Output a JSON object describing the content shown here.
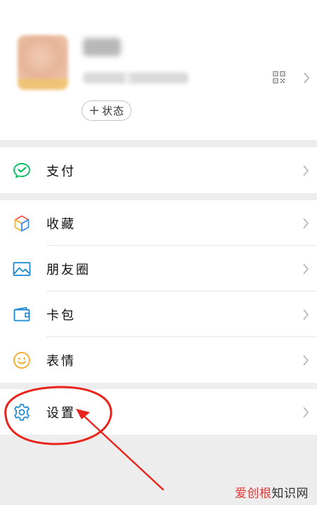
{
  "profile": {
    "status_button_plus": "+",
    "status_button_label": "状态"
  },
  "menu": {
    "pay": {
      "label": "支付",
      "icon": "wechat-pay-icon"
    },
    "favorites": {
      "label": "收藏",
      "icon": "favorites-cube-icon"
    },
    "moments": {
      "label": "朋友圈",
      "icon": "moments-photo-icon"
    },
    "cards": {
      "label": "卡包",
      "icon": "card-wallet-icon"
    },
    "stickers": {
      "label": "表情",
      "icon": "smiley-icon"
    },
    "settings": {
      "label": "设置",
      "icon": "gear-icon"
    }
  },
  "watermark": {
    "part1": "爱创根",
    "part2": "知识网"
  },
  "colors": {
    "pay_green": "#07c160",
    "icon_blue": "#1a88d4",
    "smiley_orange": "#f5a623",
    "annotation_red": "#e8241c",
    "background": "#ededed"
  }
}
